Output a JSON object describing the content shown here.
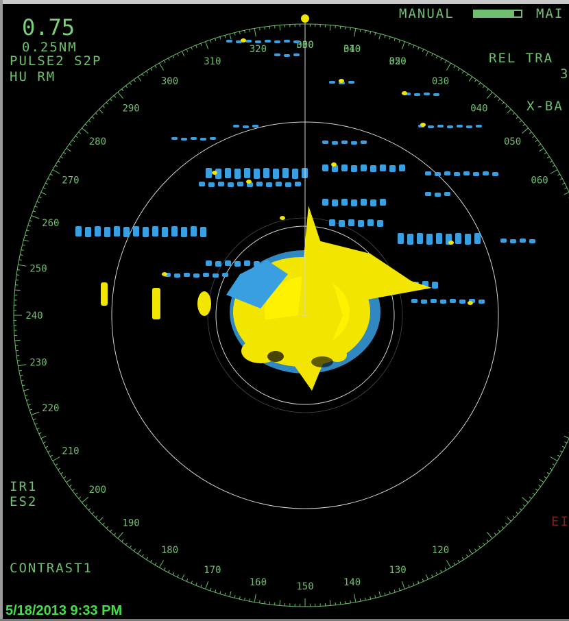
{
  "display": {
    "range": "0.75",
    "ring_interval": "0.25NM",
    "pulse_mode": "PULSE2 S2P",
    "orientation": "HU RM",
    "gain_mode": "MANUAL",
    "gain_level": 0.85,
    "mode_truncated": "MAI",
    "vector_mode": "REL TRA",
    "vector_value": "3",
    "band": "X-BA",
    "interference_rejection": "IR1",
    "echo_stretch": "ES2",
    "contrast": "CONTRAST1",
    "alarm_truncated": "EI",
    "timestamp": "5/18/2013 9:33 PM"
  },
  "bearing_labels": [
    "000",
    "010",
    "020",
    "030",
    "040",
    "050",
    "060",
    "",
    "",
    "",
    "",
    "120",
    "130",
    "140",
    "150",
    "160",
    "170",
    "180",
    "190",
    "200",
    "210",
    "220",
    "230",
    "240",
    "250",
    "260",
    "270",
    "280",
    "290",
    "300",
    "310",
    "320",
    "330",
    "340",
    "350"
  ],
  "colors": {
    "strong_echo": "#f2e600",
    "weak_echo": "#3a9fe0",
    "rings": "#cfd8cf",
    "labels": "#6fbf6f",
    "timestamp": "#44e04a"
  }
}
